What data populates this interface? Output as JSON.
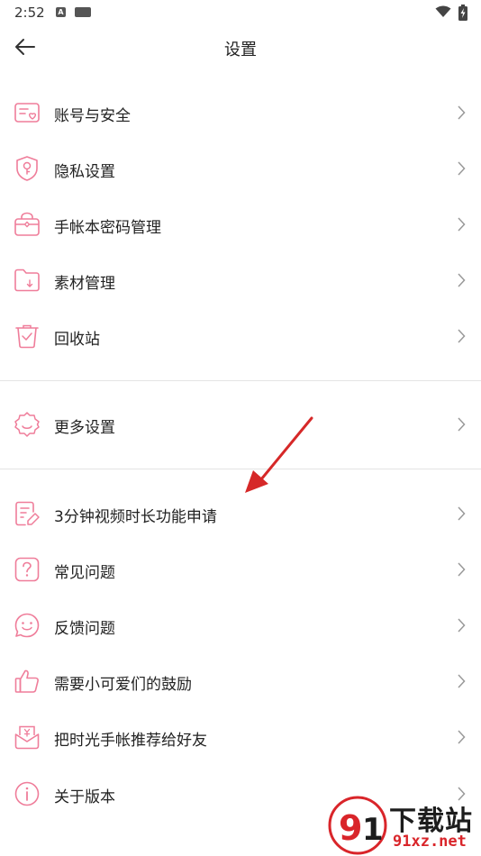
{
  "status_bar": {
    "time": "2:52",
    "icons": [
      "a-notification-icon",
      "app-notification-icon",
      "wifi-icon",
      "battery-charging-icon"
    ]
  },
  "header": {
    "title": "设置",
    "back_icon": "arrow-left-icon"
  },
  "groups": [
    {
      "items": [
        {
          "label": "账号与安全",
          "icon": "account-card-icon"
        },
        {
          "label": "隐私设置",
          "icon": "privacy-shield-icon"
        },
        {
          "label": "手帐本密码管理",
          "icon": "lock-box-icon"
        },
        {
          "label": "素材管理",
          "icon": "folder-download-icon"
        },
        {
          "label": "回收站",
          "icon": "trash-check-icon"
        }
      ]
    },
    {
      "items": [
        {
          "label": "更多设置",
          "icon": "gear-icon"
        }
      ]
    },
    {
      "items": [
        {
          "label": "3分钟视频时长功能申请",
          "icon": "document-edit-icon"
        },
        {
          "label": "常见问题",
          "icon": "question-icon"
        },
        {
          "label": "反馈问题",
          "icon": "smiley-feedback-icon"
        },
        {
          "label": "需要小可爱们的鼓励",
          "icon": "thumbs-up-icon"
        },
        {
          "label": "把时光手帐推荐给好友",
          "icon": "share-gift-icon"
        },
        {
          "label": "关于版本",
          "icon": "info-icon"
        }
      ]
    }
  ],
  "colors": {
    "icon_accent": "#ef7d9a",
    "annotation_arrow": "#d62828",
    "divider": "#e4e4e4"
  },
  "watermark": {
    "main": "下载站",
    "sub": "91xz.net"
  }
}
